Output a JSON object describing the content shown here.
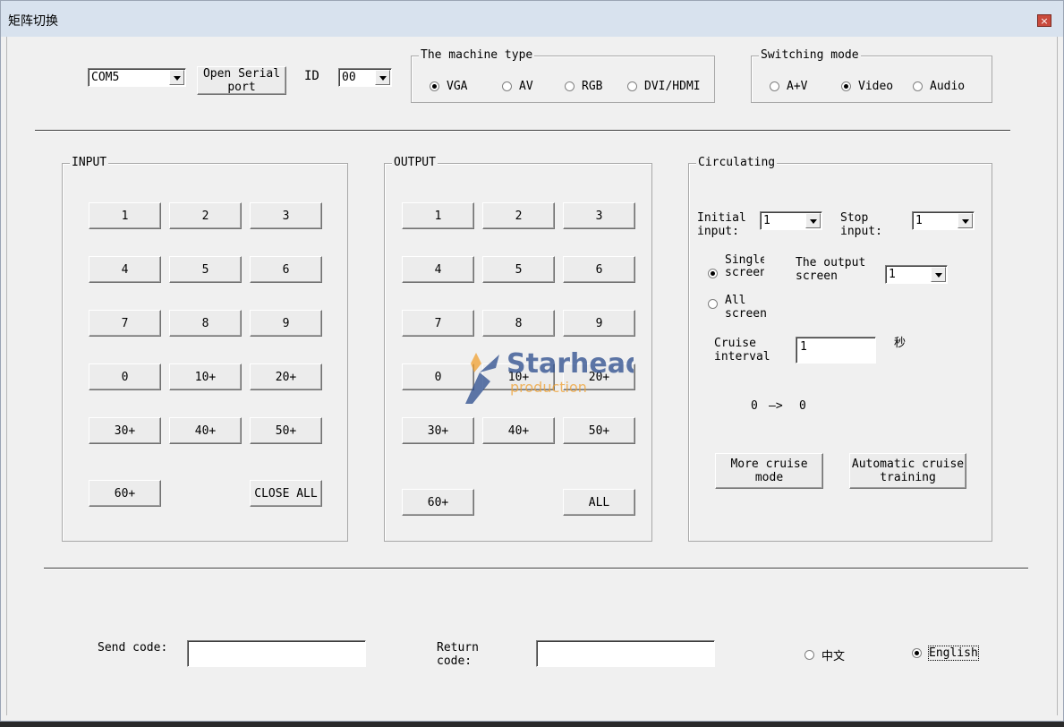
{
  "window": {
    "title": "矩阵切换",
    "close_glyph": "×"
  },
  "serial": {
    "port_value": "COM5",
    "open_button": "Open Serial port",
    "id_label": "ID",
    "id_value": "00"
  },
  "machine_type": {
    "title": "The machine type",
    "options": [
      {
        "label": "VGA",
        "selected": true
      },
      {
        "label": "AV",
        "selected": false
      },
      {
        "label": "RGB",
        "selected": false
      },
      {
        "label": "DVI/HDMI",
        "selected": false
      }
    ]
  },
  "switching_mode": {
    "title": "Switching mode",
    "options": [
      {
        "label": "A+V",
        "selected": false
      },
      {
        "label": "Video",
        "selected": true
      },
      {
        "label": "Audio",
        "selected": false
      }
    ]
  },
  "input": {
    "title": "INPUT",
    "buttons": [
      "1",
      "2",
      "3",
      "4",
      "5",
      "6",
      "7",
      "8",
      "9",
      "0",
      "10+",
      "20+",
      "30+",
      "40+",
      "50+",
      "60+"
    ],
    "close_all": "CLOSE ALL"
  },
  "output": {
    "title": "OUTPUT",
    "buttons": [
      "1",
      "2",
      "3",
      "4",
      "5",
      "6",
      "7",
      "8",
      "9",
      "0",
      "10+",
      "20+",
      "30+",
      "40+",
      "50+",
      "60+"
    ],
    "all": "ALL"
  },
  "circulating": {
    "title": "Circulating",
    "initial_input_label": "Initial input:",
    "initial_input_value": "1",
    "stop_input_label": "Stop input:",
    "stop_input_value": "1",
    "single_screen_label": "Single screen",
    "single_screen_selected": true,
    "all_screen_label": "All screen",
    "all_screen_selected": false,
    "output_screen_label": "The output screen",
    "output_screen_value": "1",
    "cruise_interval_label": "Cruise interval",
    "cruise_interval_value": "1",
    "cruise_unit": "秒",
    "progress_from": "0",
    "progress_arrow": "—>",
    "progress_to": "0",
    "more_cruise_button": "More cruise mode",
    "auto_cruise_button": "Automatic cruise training"
  },
  "footer": {
    "send_code_label": "Send code:",
    "send_code_value": "",
    "return_code_label": "Return code:",
    "return_code_value": "",
    "lang_chinese": "中文",
    "lang_chinese_selected": false,
    "lang_english": "English",
    "lang_english_selected": true
  },
  "watermark": {
    "brand": "Starhead",
    "sub": "production",
    "colors": {
      "blue": "#2a4b8c",
      "orange": "#f0a030"
    }
  }
}
